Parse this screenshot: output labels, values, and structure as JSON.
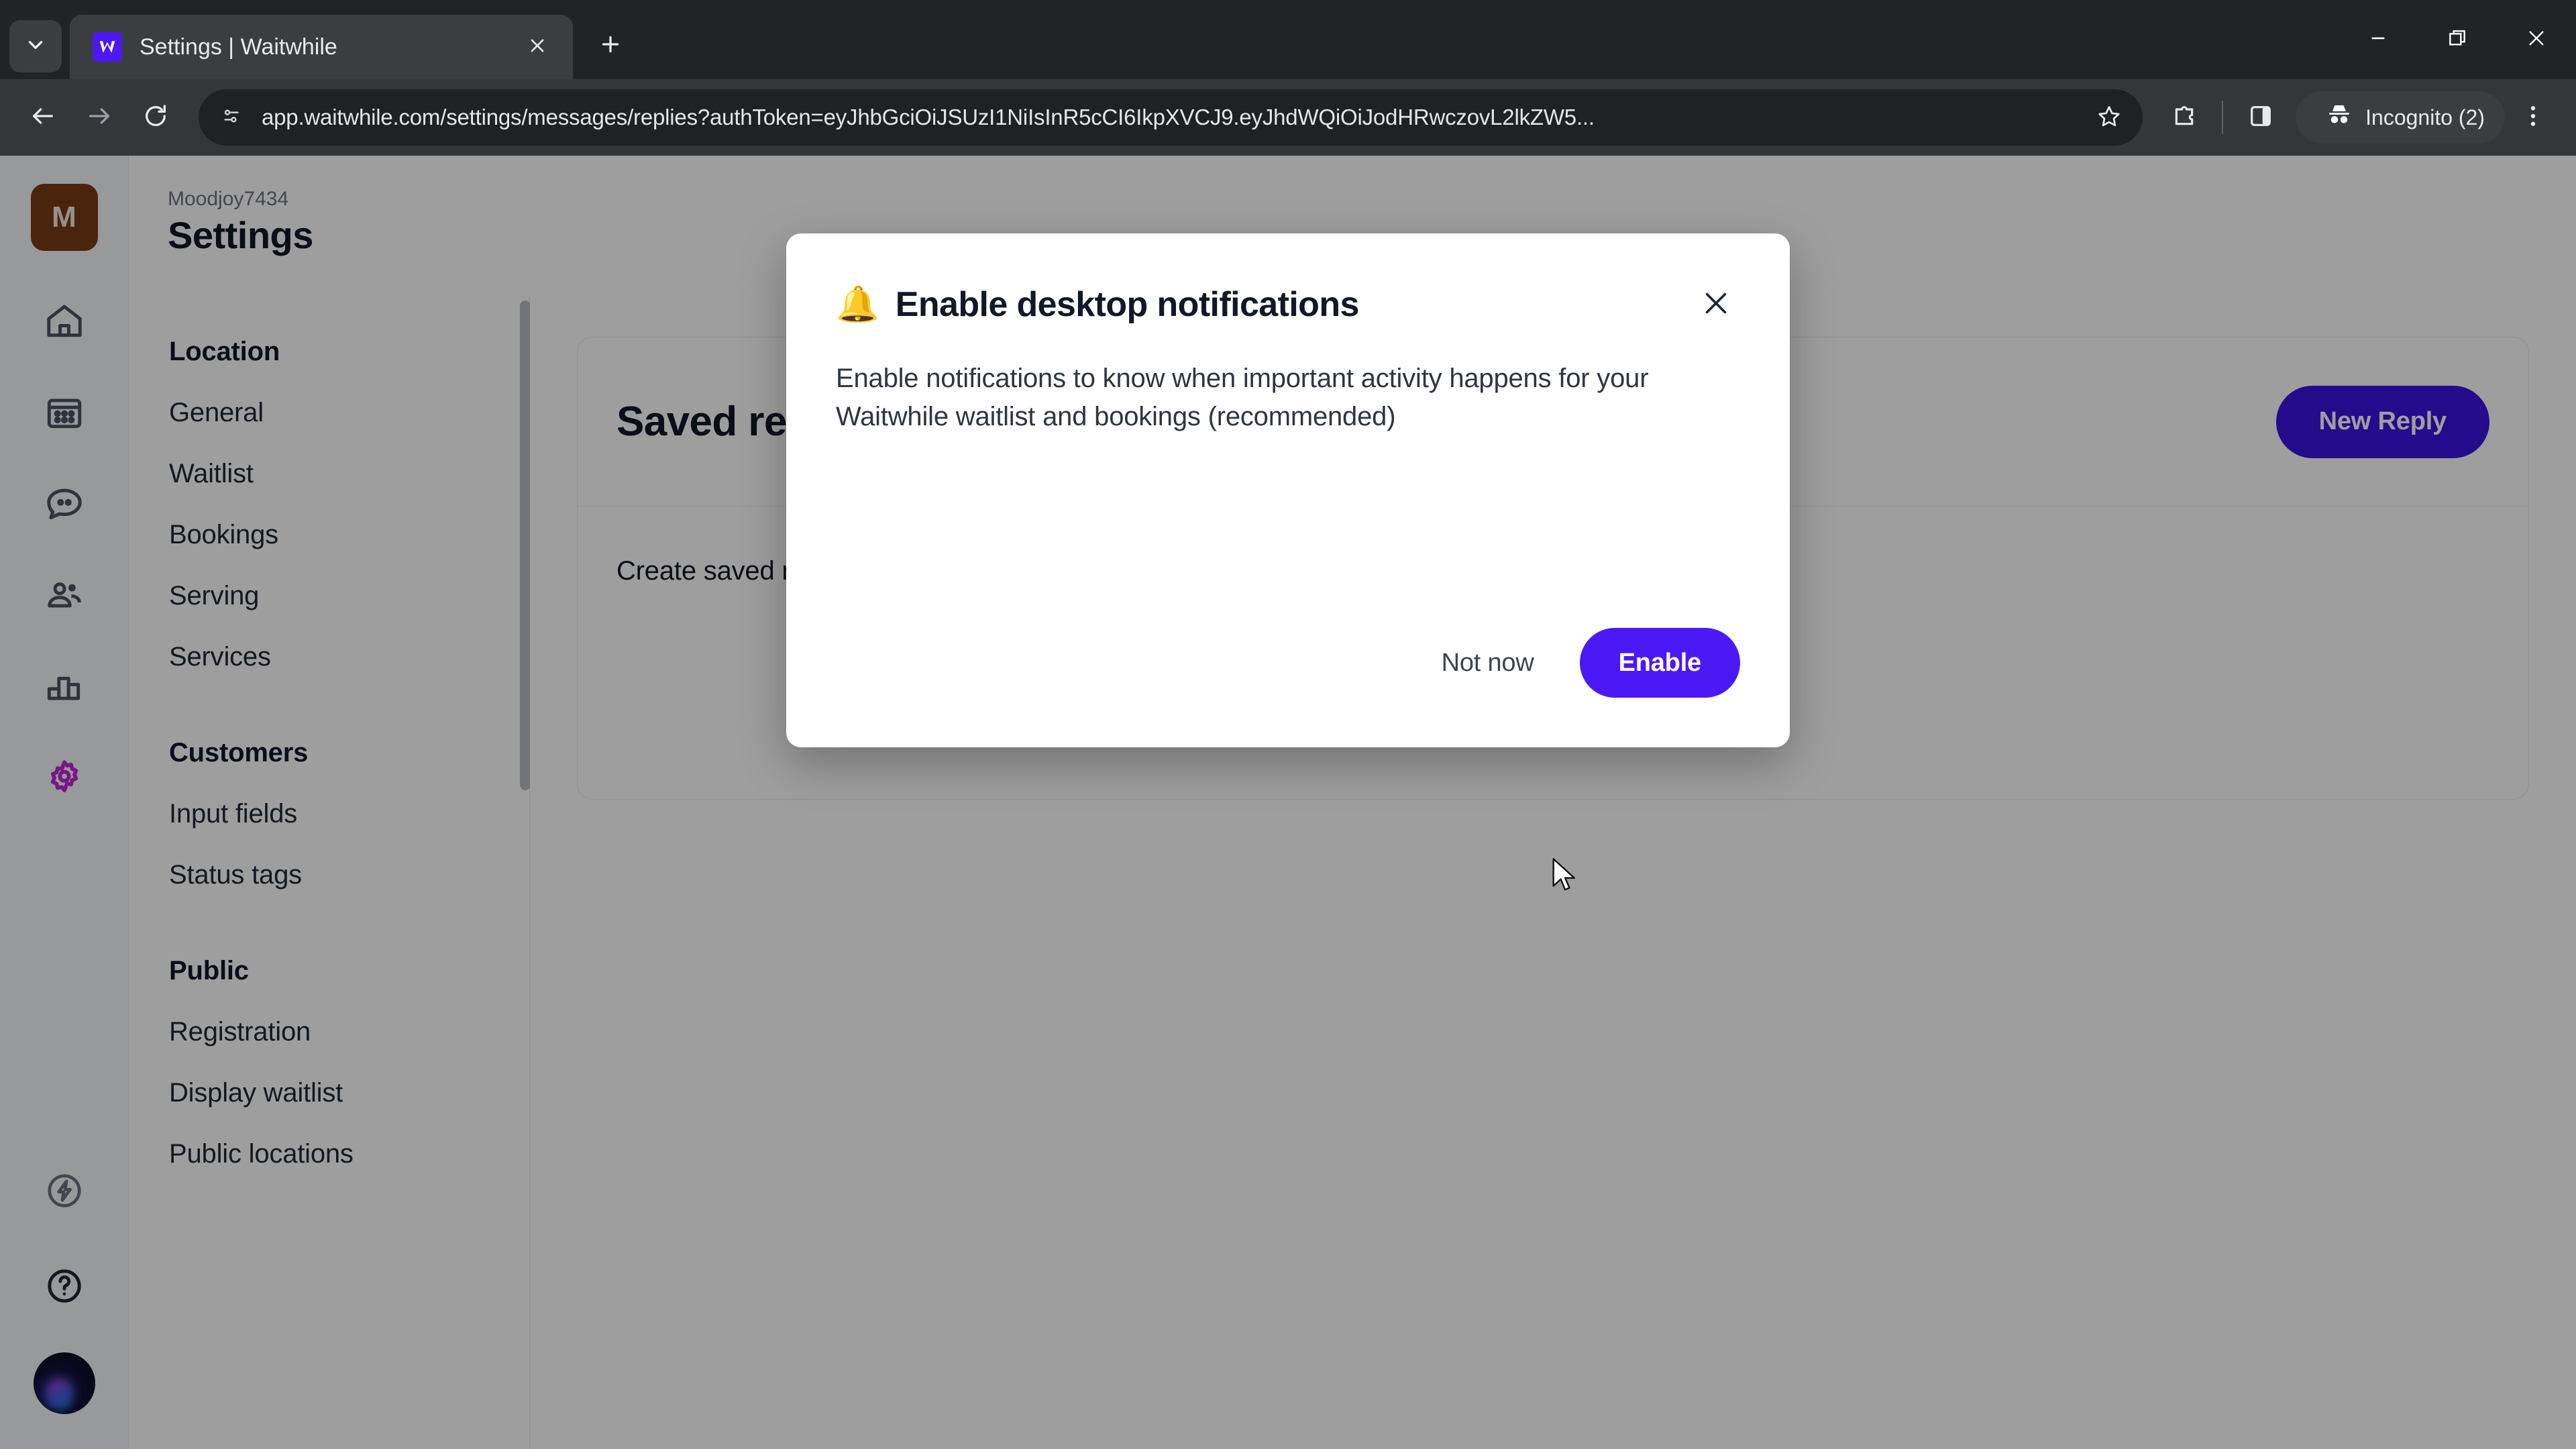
{
  "browser": {
    "tab": {
      "title": "Settings | Waitwhile",
      "favicon_letter": "W",
      "favicon_color": "#4d18f0",
      "close_icon": "close-icon"
    },
    "tab_list_icon": "chevron-down-icon",
    "new_tab_icon": "plus-icon",
    "window_controls": {
      "minimize": "minimize-icon",
      "maximize": "restore-icon",
      "close": "close-icon"
    },
    "toolbar": {
      "back_icon": "back-arrow-icon",
      "forward_icon": "forward-arrow-icon",
      "reload_icon": "reload-icon",
      "site_info_icon": "page-info-icon",
      "url": "app.waitwhile.com/settings/messages/replies?authToken=eyJhbGciOiJSUzI1NiIsInR5cCI6IkpXVCJ9.eyJhdWQiOiJodHRwczovL2lkZW5...",
      "bookmark_icon": "star-icon",
      "extensions_icon": "extensions-puzzle-icon",
      "split_view_icon": "side-panel-icon",
      "profile_label": "Incognito (2)",
      "profile_icon": "incognito-icon",
      "menu_icon": "three-dots-menu-icon"
    }
  },
  "app": {
    "rail": {
      "workspace_initial": "M",
      "workspace_color": "#7a3a16",
      "items": [
        {
          "name": "home-icon",
          "label": "Home",
          "active": false
        },
        {
          "name": "calendar-icon",
          "label": "Bookings",
          "active": false
        },
        {
          "name": "chat-bubble-icon",
          "label": "Messages",
          "active": false
        },
        {
          "name": "people-icon",
          "label": "Customers",
          "active": false
        },
        {
          "name": "bar-chart-icon",
          "label": "Analytics",
          "active": false
        },
        {
          "name": "gear-icon",
          "label": "Settings",
          "active": true
        }
      ],
      "active_color": "#c026d3",
      "bottom_items": [
        {
          "name": "lightning-icon",
          "label": "Automations"
        },
        {
          "name": "help-circle-icon",
          "label": "Help"
        }
      ],
      "avatar": "user-avatar"
    },
    "header": {
      "breadcrumb": "Moodjoy7434",
      "title": "Settings"
    },
    "subnav": {
      "groups": [
        {
          "title": "Location",
          "items": [
            "General",
            "Waitlist",
            "Bookings",
            "Serving",
            "Services"
          ]
        },
        {
          "title": "Customers",
          "items": [
            "Input fields",
            "Status tags"
          ]
        },
        {
          "title": "Public",
          "items": [
            "Registration",
            "Display waitlist",
            "Public locations"
          ]
        }
      ]
    },
    "content": {
      "card_title": "Saved replies",
      "new_reply_label": "New Reply",
      "description": "Create saved replies to common questions.",
      "primary_color": "#3b12e0"
    }
  },
  "modal": {
    "icon": "bell-icon",
    "icon_glyph": "🔔",
    "title": "Enable desktop notifications",
    "close_icon": "close-icon",
    "body": "Enable notifications to know when important activity happens for your Waitwhile waitlist and bookings (recommended)",
    "secondary_label": "Not now",
    "primary_label": "Enable",
    "primary_color": "#4a19f5"
  }
}
